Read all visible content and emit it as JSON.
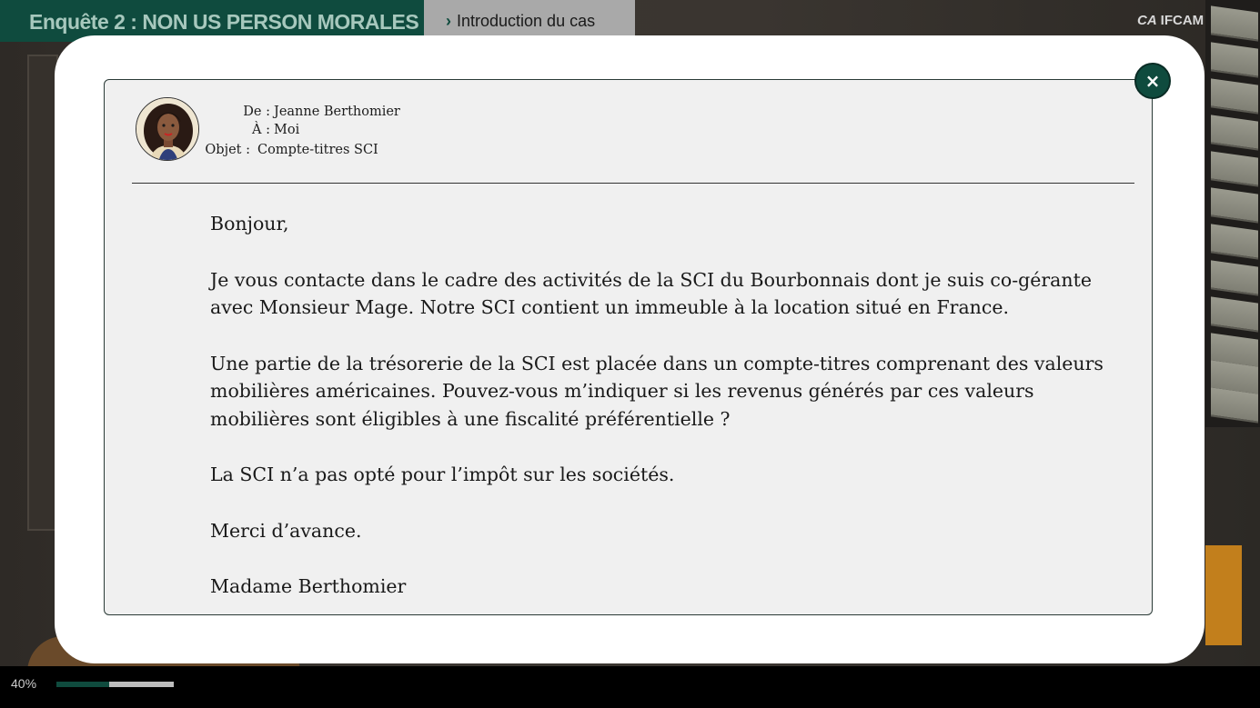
{
  "header": {
    "title": "Enquête 2 : NON US PERSON MORALES",
    "breadcrumb": "Introduction du cas",
    "logo_text": "IFCAM",
    "logo_mark": "CA"
  },
  "progress": {
    "label": "40%",
    "value": 0.45
  },
  "mail": {
    "from_label": "De :",
    "from_value": "Jeanne Berthomier",
    "to_label": "À :",
    "to_value": "Moi",
    "subject_label": "Objet :",
    "subject_value": "Compte-titres SCI",
    "paragraphs": [
      "Bonjour,",
      "Je vous contacte dans le cadre des activités de la SCI du Bourbonnais dont je suis co-gérante avec Monsieur Mage. Notre SCI contient un immeuble à la location situé en France.",
      "Une partie de la trésorerie de la SCI est placée dans un compte-titres comprenant des valeurs mobilières américaines. Pouvez-vous m’indiquer si les revenus générés par ces valeurs mobilières sont éligibles à une fiscalité préférentielle ?",
      "La SCI n’a pas opté pour l’impôt sur les sociétés.",
      "Merci d’avance.",
      "Madame Berthomier"
    ]
  },
  "close_button": {
    "label": "×"
  },
  "colors": {
    "brand_green": "#0f4b3e",
    "modal_bg": "#ffffff",
    "mail_bg": "#f0f0f0"
  },
  "icons": {
    "close": "close-icon",
    "avatar": "avatar-portrait",
    "breadcrumb": "chevron-right-icon"
  }
}
